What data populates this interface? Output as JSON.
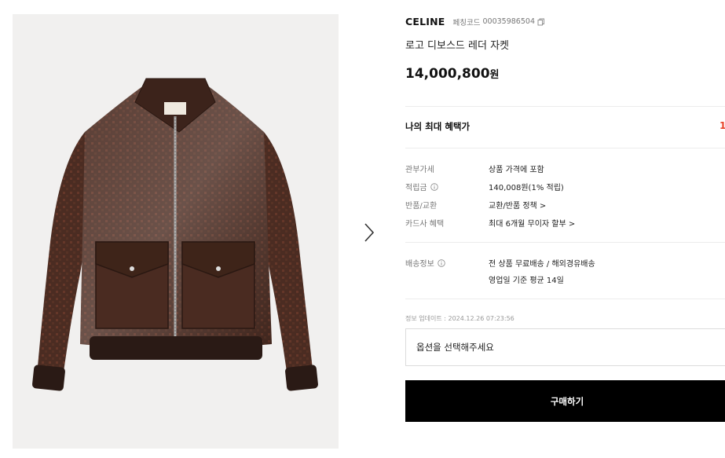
{
  "product": {
    "brand": "CELINE",
    "code_label": "페칭코드",
    "code_value": "00035986504",
    "title": "로고 디보스드 레더 자켓",
    "price": "14,000,800",
    "price_unit": "원"
  },
  "benefit": {
    "label": "나의 최대 혜택가",
    "amount_partial": "1"
  },
  "details": [
    {
      "label": "관부가세",
      "value": "상품 가격에 포함"
    },
    {
      "label": "적립금",
      "value": "140,008원(1% 적립)"
    },
    {
      "label": "반품/교환",
      "value": "교환/반품 정책 >"
    },
    {
      "label": "카드사 혜택",
      "value": "최대 6개월 무이자 할부 >"
    }
  ],
  "shipping": {
    "label": "배송정보",
    "line1": "전 상품 무료배송 / 해외경유배송",
    "line2": "영업일 기준 평균 14일"
  },
  "update_info": "정보 업데이트 : 2024.12.26 07:23:56",
  "option_placeholder": "옵션을 선택해주세요",
  "buy_label": "구매하기",
  "icons": {
    "next": "chevron-right-icon",
    "copy": "copy-icon",
    "info": "info-icon"
  },
  "colors": {
    "accent": "#e8442a",
    "button_bg": "#000000",
    "jacket": "#4a2e24"
  }
}
